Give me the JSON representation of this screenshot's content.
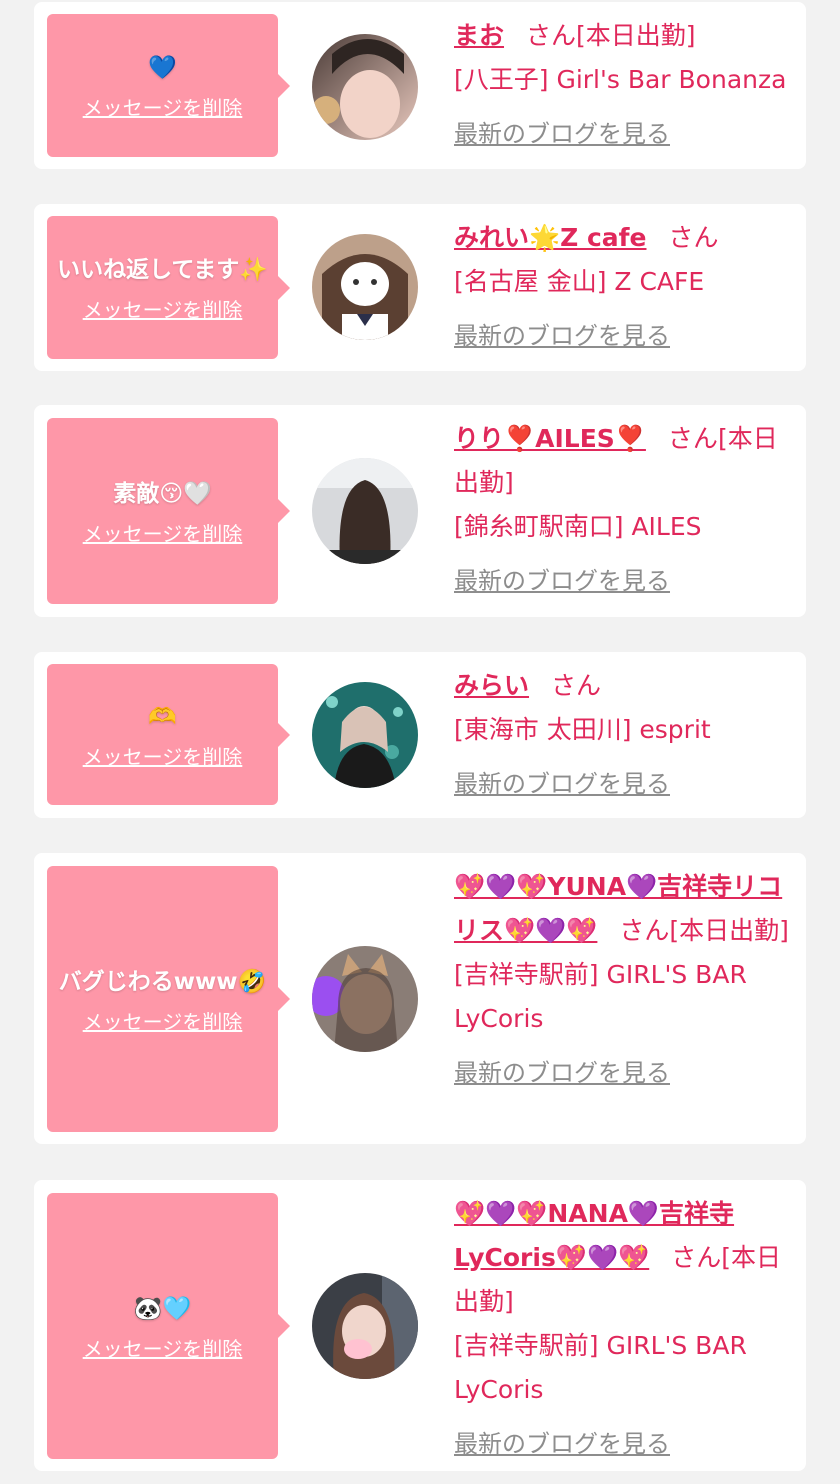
{
  "ui": {
    "delete_label": "メッセージを削除",
    "blog_label": "最新のブログを見る",
    "san": "さん"
  },
  "items": [
    {
      "message": "💙",
      "name": "まお",
      "status": "[本日出勤]",
      "shop": "[八王子] Girl's Bar Bonanza"
    },
    {
      "message": "いいね返してます✨",
      "name": "みれい🌟Z cafe",
      "status": "",
      "shop": "[名古屋 金山] Z CAFE"
    },
    {
      "message": "素敵😚🤍",
      "name": "りり❣️AILES❣️",
      "status": "[本日出勤]",
      "shop": "[錦糸町駅南口] AILES"
    },
    {
      "message": "🫶",
      "name": "みらい",
      "status": "",
      "shop": "[東海市 太田川] esprit"
    },
    {
      "message": "バグじわるwww🤣",
      "name": "💖💜💖YUNA💜吉祥寺リコリス💖💜💖",
      "status": "[本日出勤]",
      "shop": "[吉祥寺駅前] GIRL'S BAR LyCoris"
    },
    {
      "message": "🐼🩵",
      "name": "💖💜💖NANA💜吉祥寺LyCoris💖💜💖",
      "status": "[本日出勤]",
      "shop": "[吉祥寺駅前] GIRL'S BAR LyCoris"
    }
  ]
}
